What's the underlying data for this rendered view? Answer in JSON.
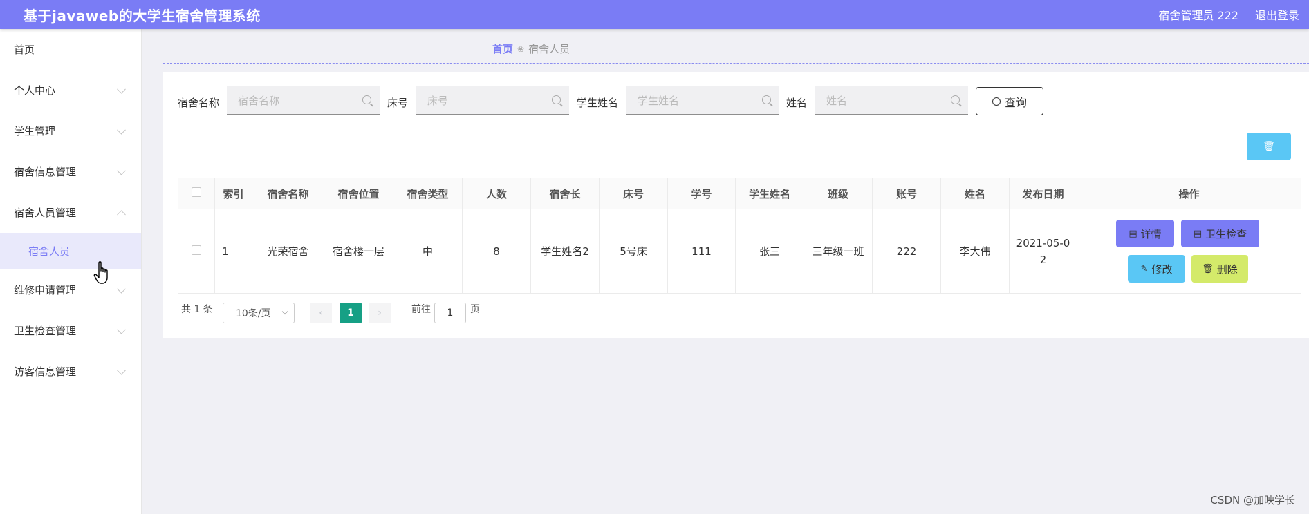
{
  "header": {
    "title": "基于javaweb的大学生宿舍管理系统",
    "user": "宿舍管理员 222",
    "logout": "退出登录"
  },
  "sidebar": {
    "items": [
      {
        "label": "首页"
      },
      {
        "label": "个人中心"
      },
      {
        "label": "学生管理"
      },
      {
        "label": "宿舍信息管理"
      },
      {
        "label": "宿舍人员管理"
      },
      {
        "label": "维修申请管理"
      },
      {
        "label": "卫生检查管理"
      },
      {
        "label": "访客信息管理"
      }
    ],
    "sub_item": "宿舍人员"
  },
  "breadcrumb": {
    "home": "首页",
    "current": "宿舍人员"
  },
  "search": {
    "fields": [
      {
        "label": "宿舍名称",
        "placeholder": "宿舍名称"
      },
      {
        "label": "床号",
        "placeholder": "床号"
      },
      {
        "label": "学生姓名",
        "placeholder": "学生姓名"
      },
      {
        "label": "姓名",
        "placeholder": "姓名"
      }
    ],
    "query_label": "查询"
  },
  "table": {
    "headers": [
      "索引",
      "宿舍名称",
      "宿舍位置",
      "宿舍类型",
      "人数",
      "宿舍长",
      "床号",
      "学号",
      "学生姓名",
      "班级",
      "账号",
      "姓名",
      "发布日期",
      "操作"
    ],
    "rows": [
      {
        "index": "1",
        "dorm_name": "光荣宿舍",
        "location": "宿舍楼一层",
        "type": "中",
        "count": "8",
        "leader": "学生姓名2",
        "bed": "5号床",
        "student_no": "111",
        "student_name": "张三",
        "class": "三年级一班",
        "account": "222",
        "name": "李大伟",
        "date_1": "2021-05-0",
        "date_2": "2"
      }
    ],
    "actions": {
      "detail": "详情",
      "hygiene": "卫生检查",
      "edit": "修改",
      "delete": "删除"
    }
  },
  "pagination": {
    "total": "共 1 条",
    "page_size": "10条/页",
    "current_page": "1",
    "goto_label": "前往",
    "goto_value": "1",
    "page_suffix": "页"
  },
  "watermark": "CSDN @加映学长",
  "colors": {
    "primary": "#7a7cf5",
    "info": "#5ac7f5",
    "warning": "#d4ea6a",
    "success": "#16a085"
  }
}
